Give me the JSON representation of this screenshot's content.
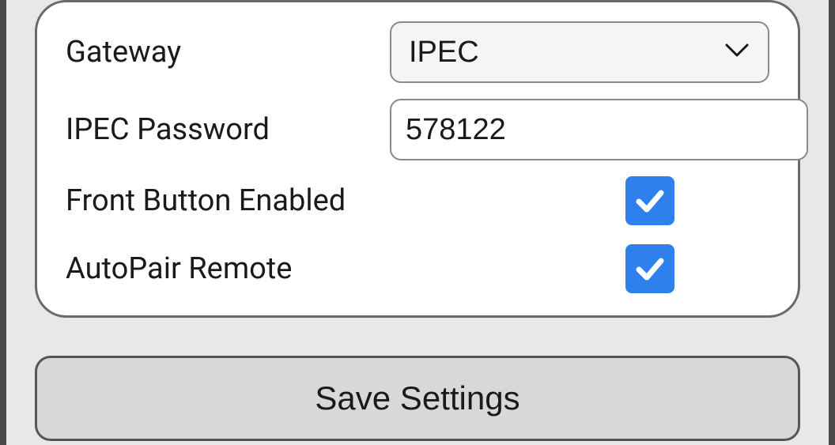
{
  "settings": {
    "gateway": {
      "label": "Gateway",
      "value": "IPEC"
    },
    "ipecPassword": {
      "label": "IPEC Password",
      "value": "578122"
    },
    "frontButton": {
      "label": "Front Button Enabled",
      "checked": true
    },
    "autoPair": {
      "label": "AutoPair Remote",
      "checked": true
    }
  },
  "actions": {
    "saveLabel": "Save Settings"
  }
}
